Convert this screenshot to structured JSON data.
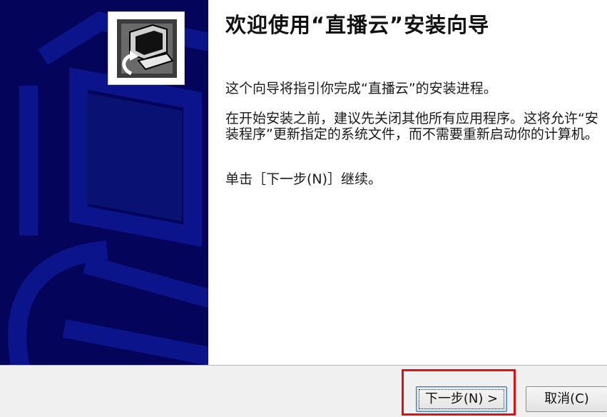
{
  "wizard": {
    "title": "欢迎使用“直播云”安装向导",
    "paragraphs": [
      "这个向导将指引你完成“直播云”的安装进程。",
      "在开始安装之前，建议先关闭其他所有应用程序。这将允许“安装程序”更新指定的系统文件，而不需要重新启动你的计算机。",
      "单击［下一步(N)］继续。"
    ]
  },
  "buttons": {
    "next_label": "下一步(N) >",
    "cancel_label": "取消(C)"
  },
  "colors": {
    "banner": "#04045a",
    "highlight": "#e01010"
  },
  "icons": {
    "installer_logo": "installer-computer-icon"
  }
}
